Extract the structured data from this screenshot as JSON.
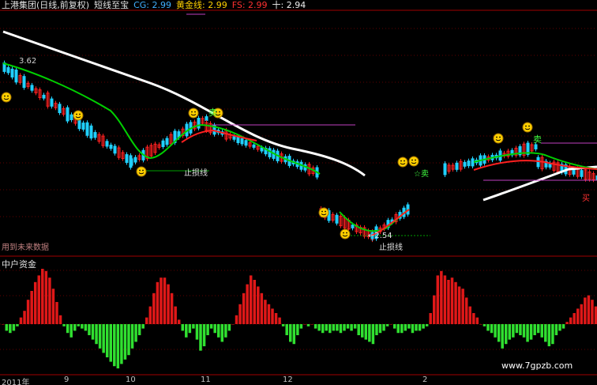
{
  "header": {
    "stock": "上港集团(日线,前复权)",
    "indicator": "短线至宝",
    "cg": "CG: 2.99",
    "gold": "黄金线: 2.99",
    "fs": "FS: 2.99",
    "ten": "十: 2.94"
  },
  "colors": {
    "up": "#ff2020",
    "down": "#20d0ff",
    "ma_short": "#00d000",
    "ma_long": "#ffffff",
    "stop_line": "#00a000",
    "magenta": "#c040c0",
    "label_yellow": "#ffd000"
  },
  "annotations": {
    "price_mark": "3.62",
    "stop_loss_1": "止损线",
    "stop_loss_2": "止损线",
    "stop_loss_arrow": "←2.54",
    "sell_star": "☆卖",
    "buy_mark": "买",
    "future_data": "用到未来数据",
    "sell_mark_1": "卖",
    "sell_mark_2": "卖"
  },
  "lower_panel": {
    "title": "中户资金"
  },
  "x_axis": {
    "labels": [
      "2011年",
      "9",
      "10",
      "11",
      "12",
      "2"
    ]
  },
  "watermark": "www.7gpzb.com",
  "chart_data": [
    {
      "type": "candlestick",
      "title": "上港集团(日线,前复权)",
      "annotations": [
        "3.62",
        "←2.54"
      ],
      "series": [
        {
          "name": "黄金线",
          "values_known": [
            2.99
          ]
        },
        {
          "name": "FS",
          "values_known": [
            2.99
          ]
        }
      ]
    },
    {
      "type": "bar",
      "title": "中户资金",
      "values": [
        0,
        -3,
        -4,
        -3,
        -1,
        3,
        6,
        11,
        15,
        19,
        22,
        25,
        24,
        21,
        16,
        10,
        4,
        -1,
        -4,
        -6,
        -3,
        -1,
        -2,
        -3,
        -5,
        -7,
        -9,
        -11,
        -13,
        -15,
        -17,
        -19,
        -20,
        -18,
        -16,
        -14,
        -11,
        -8,
        -5,
        -2,
        3,
        8,
        14,
        19,
        21,
        21,
        18,
        14,
        8,
        2,
        -3,
        -6,
        -4,
        -2,
        -7,
        -12,
        -10,
        -5,
        -2,
        -4,
        -6,
        -8,
        -6,
        -3,
        0,
        4,
        9,
        14,
        18,
        22,
        20,
        17,
        14,
        11,
        9,
        7,
        5,
        3,
        -1,
        -5,
        -8,
        -9,
        -5,
        -2,
        0,
        -1,
        0,
        -2,
        -3,
        -4,
        -3,
        -4,
        -3,
        -3,
        -4,
        -3,
        -2,
        -3,
        -2,
        -5,
        -6,
        -7,
        -8,
        -9,
        -5,
        -4,
        -3,
        -1,
        0,
        -2,
        -4,
        -4,
        -3,
        -2,
        -4,
        -3,
        -3,
        -2,
        -1,
        5,
        13,
        22,
        24,
        22,
        20,
        21,
        19,
        17,
        16,
        12,
        8,
        5,
        3,
        0,
        -1,
        -3,
        -4,
        -6,
        -8,
        -11,
        -9,
        -7,
        -6,
        -4,
        -5,
        -6,
        -8,
        -7,
        -5,
        -4,
        -6,
        -8,
        -10,
        -9,
        -5,
        -3,
        -2,
        1,
        3,
        5,
        7,
        9,
        12,
        13,
        11,
        8,
        5,
        3
      ]
    }
  ]
}
